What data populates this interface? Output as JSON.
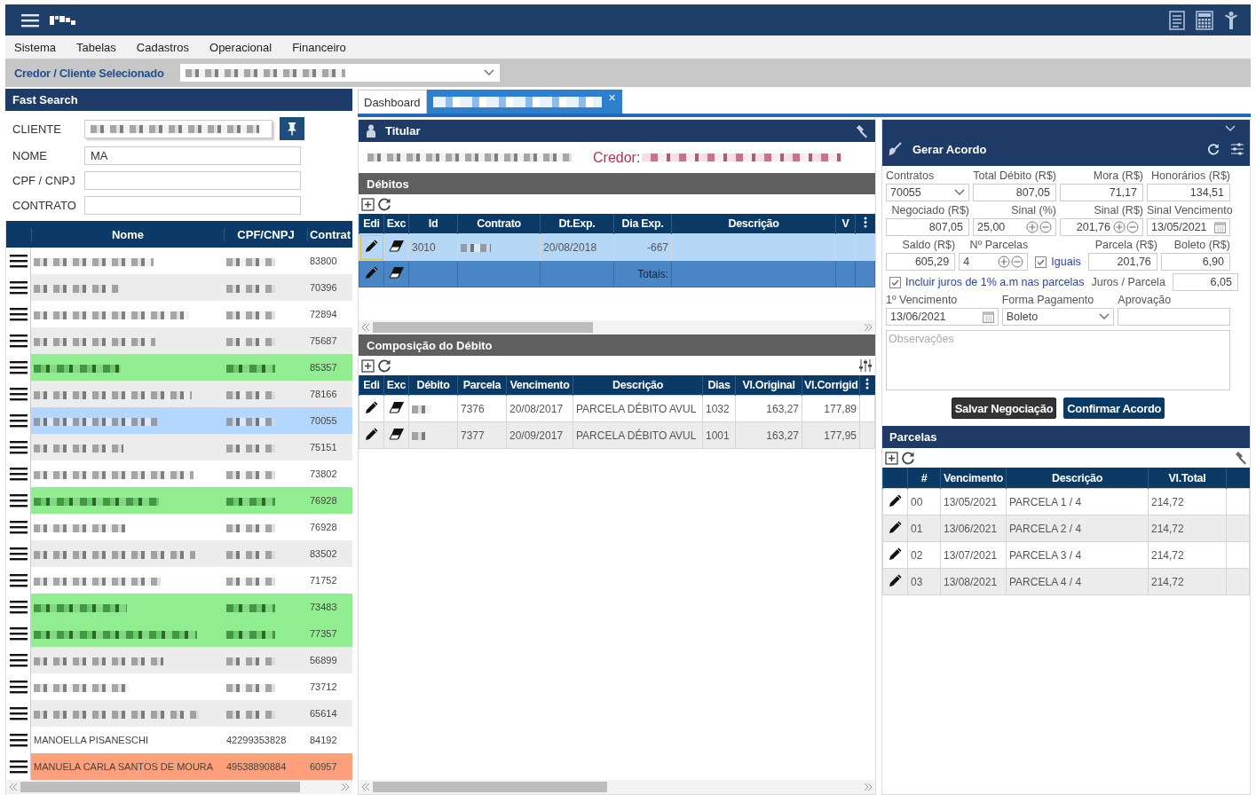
{
  "topbar": {
    "menu": [
      "Sistema",
      "Tabelas",
      "Cadastros",
      "Operacional",
      "Financeiro"
    ]
  },
  "credor_bar": {
    "label": "Credor / Cliente Selecionado"
  },
  "fast_search": {
    "title": "Fast Search",
    "fields": [
      {
        "label": "CLIENTE",
        "kind": "pinned"
      },
      {
        "label": "NOME",
        "value": "MA",
        "kind": "text"
      },
      {
        "label": "CPF / CNPJ",
        "kind": "text"
      },
      {
        "label": "CONTRATO",
        "kind": "text"
      }
    ]
  },
  "clients": {
    "columns": [
      "Nome",
      "CPF/CNPJ",
      "Contrat"
    ],
    "rows": [
      {
        "contract": "83800",
        "selected": false
      },
      {
        "contract": "70396",
        "selected": false
      },
      {
        "contract": "72894",
        "selected": false
      },
      {
        "contract": "75687",
        "selected": false
      },
      {
        "contract": "85357",
        "selected": false,
        "color": "#90ee90"
      },
      {
        "contract": "78166",
        "selected": false
      },
      {
        "contract": "70055",
        "selected": true
      },
      {
        "contract": "75151",
        "selected": false
      },
      {
        "contract": "73802",
        "selected": false
      },
      {
        "contract": "76928",
        "selected": false,
        "color": "#90ee90"
      },
      {
        "contract": "76928",
        "selected": false
      },
      {
        "contract": "83502",
        "selected": false
      },
      {
        "contract": "71752",
        "selected": false
      },
      {
        "contract": "73483",
        "selected": false,
        "color": "#90ee90"
      },
      {
        "contract": "77357",
        "selected": false,
        "color": "#90ee90"
      },
      {
        "contract": "56899",
        "selected": false
      },
      {
        "contract": "73712",
        "selected": false
      },
      {
        "contract": "65614",
        "selected": false
      },
      {
        "name": "MANOELLA PISANESCHI",
        "cpf": "42299353828",
        "contract": "84192",
        "selected": false
      },
      {
        "name": "MANUELA CARLA SANTOS DE MOURA",
        "cpf": "49538890884",
        "contract": "60957",
        "selected": false,
        "color": "#ffa07a"
      }
    ]
  },
  "tabs": [
    {
      "label": "Dashboard",
      "selected": false
    },
    {
      "selected": true,
      "close": "×"
    }
  ],
  "titular": {
    "title": "Titular",
    "credor_label": "Credor:"
  },
  "debitos": {
    "title": "Débitos",
    "columns": [
      "Edi",
      "Exc",
      "Id",
      "Contrato",
      "Dt.Exp.",
      "Dia Exp.",
      "Descrição",
      "V"
    ],
    "rows": [
      {
        "id": "3010",
        "dt_exp": "20/08/2018",
        "dia_exp": "-667",
        "selected": true
      }
    ],
    "totals_label": "Totais:"
  },
  "composicao": {
    "title": "Composição do Débito",
    "columns": [
      "Edi",
      "Exc",
      "Débito",
      "Parcela",
      "Vencimento",
      "Descrição",
      "Dias",
      "Vl.Original",
      "Vl.Corrigid"
    ],
    "rows": [
      {
        "parcela": "7376",
        "vencimento": "20/08/2017",
        "descricao": "PARCELA DÉBITO AVUL",
        "dias": "1032",
        "original": "163,27",
        "corrigido": "177,89"
      },
      {
        "parcela": "7377",
        "vencimento": "20/09/2017",
        "descricao": "PARCELA DÉBITO AVUL",
        "dias": "1001",
        "original": "163,27",
        "corrigido": "177,95"
      }
    ]
  },
  "acordo": {
    "title": "Gerar Acordo",
    "rows": [
      {
        "fields": [
          {
            "label": "Contratos",
            "value": "70055",
            "kind": "select"
          },
          {
            "label": "Total Débito (R$)",
            "value": "807,05",
            "kind": "number"
          },
          {
            "label": "Mora (R$)",
            "value": "71,17",
            "kind": "number"
          },
          {
            "label": "Honorários (R$)",
            "value": "134,51",
            "kind": "number"
          }
        ]
      },
      {
        "fields": [
          {
            "label": "Negociado (R$)",
            "value": "807,05",
            "kind": "number"
          },
          {
            "label": "Sinal (%)",
            "value": "25,00",
            "kind": "stepper"
          },
          {
            "label": "Sinal (R$)",
            "value": "201,76",
            "kind": "stepper"
          },
          {
            "label": "Sinal Vencimento",
            "value": "13/05/2021",
            "kind": "date"
          }
        ]
      },
      {
        "fields": [
          {
            "label": "Saldo (R$)",
            "value": "605,29",
            "kind": "number"
          },
          {
            "label": "Nº Parcelas",
            "value": "4",
            "kind": "stepper"
          },
          {
            "label": "Iguais",
            "checked": true,
            "kind": "checkbox"
          },
          {
            "label": "Parcela (R$)",
            "value": "201,76",
            "kind": "number"
          },
          {
            "label": "Boleto (R$)",
            "value": "6,90",
            "kind": "number"
          }
        ]
      },
      {
        "fields": [
          {
            "label": "Incluir juros de 1% a.m nas parcelas",
            "checked": true,
            "kind": "checkbox"
          },
          {
            "label": "Juros / Parcela",
            "value": "6,05",
            "kind": "inline"
          }
        ]
      },
      {
        "fields": [
          {
            "label": "1º Vencimento",
            "value": "13/06/2021",
            "kind": "date"
          },
          {
            "label": "Forma Pagamento",
            "value": "Boleto",
            "kind": "select"
          },
          {
            "label": "Aprovação",
            "kind": "text"
          }
        ]
      }
    ],
    "notes_placeholder": "Observações",
    "buttons": [
      {
        "label": "Salvar Negociação",
        "kind": "secondary"
      },
      {
        "label": "Confirmar Acordo",
        "kind": "primary"
      }
    ]
  },
  "parcelas": {
    "title": "Parcelas",
    "columns": [
      "#",
      "Vencimento",
      "Descrição",
      "Vl.Total"
    ],
    "rows": [
      {
        "num": "00",
        "vencimento": "13/05/2021",
        "descricao": "PARCELA 1 / 4",
        "total": "214,72"
      },
      {
        "num": "01",
        "vencimento": "13/06/2021",
        "descricao": "PARCELA 2 / 4",
        "total": "214,72"
      },
      {
        "num": "02",
        "vencimento": "13/07/2021",
        "descricao": "PARCELA 3 / 4",
        "total": "214,72"
      },
      {
        "num": "03",
        "vencimento": "13/08/2021",
        "descricao": "PARCELA 4 / 4",
        "total": "214,72"
      }
    ]
  }
}
